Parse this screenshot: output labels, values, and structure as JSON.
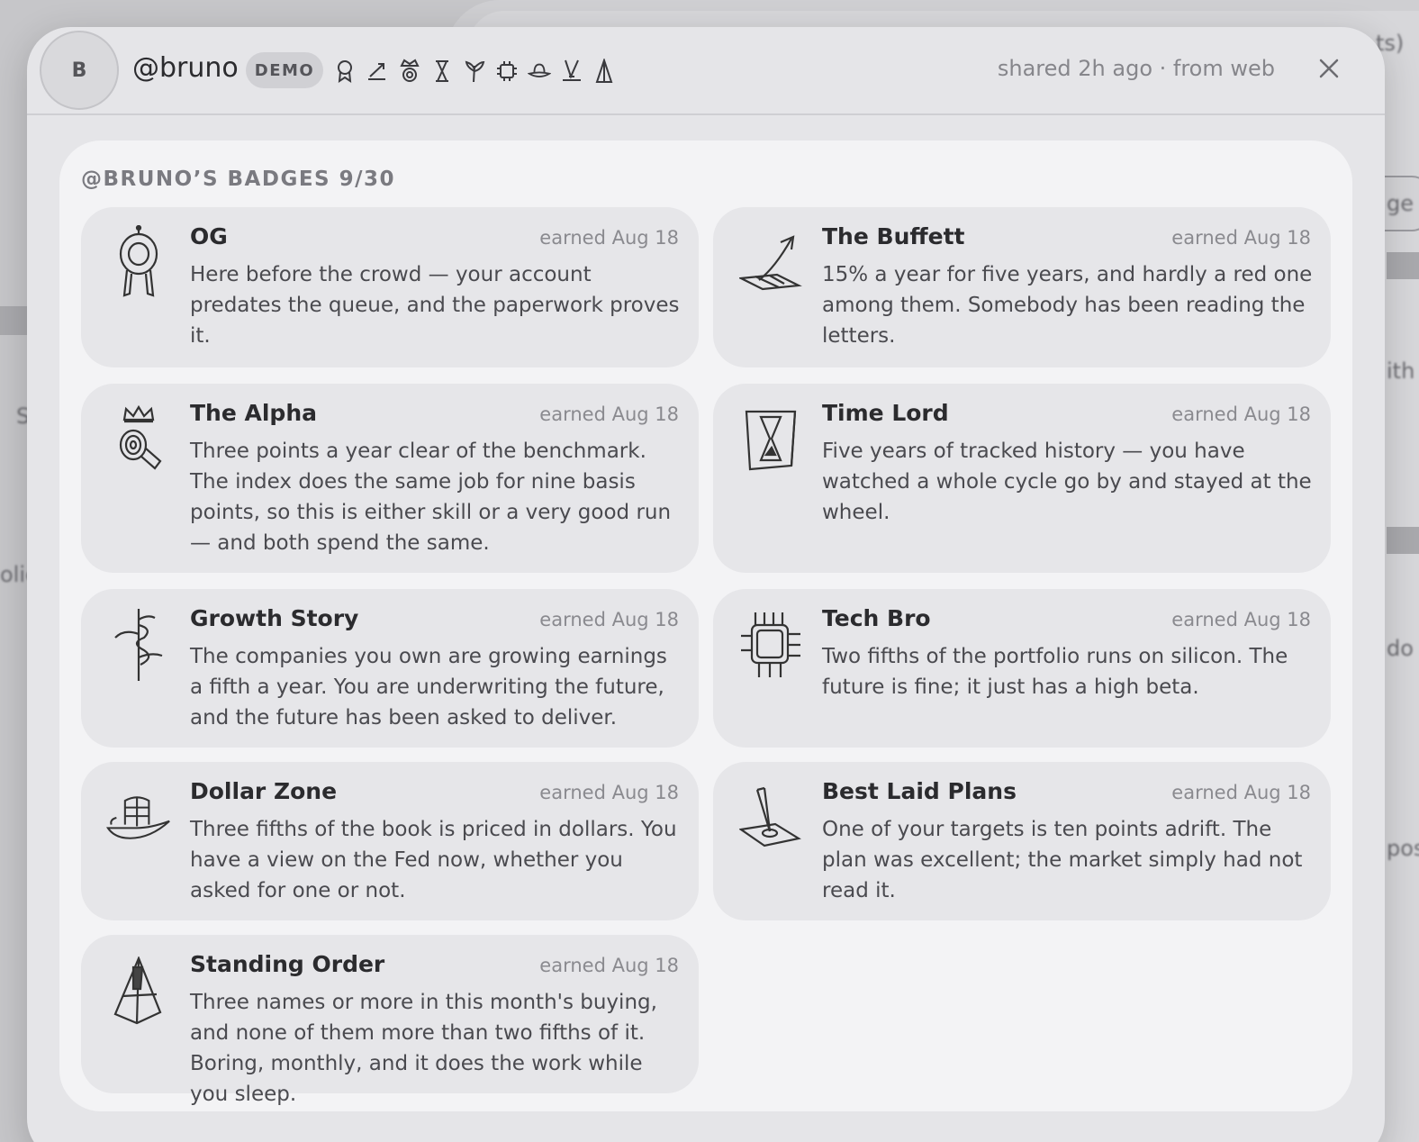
{
  "background": {
    "fragments": [
      "ts)",
      "ge",
      "ith",
      "S",
      "olic",
      "do",
      "post"
    ]
  },
  "header": {
    "avatar_initial": "B",
    "username": "@bruno",
    "demo_label": "DEMO",
    "icons": [
      "ribbon-icon",
      "chart-up-icon",
      "crown-icon",
      "hourglass-icon",
      "sprout-icon",
      "chip-icon",
      "hat-icon",
      "plan-icon",
      "pyramid-icon"
    ],
    "share_meta": "shared 2h ago · from web",
    "close_icon": "close-icon"
  },
  "badges": {
    "title": "@BRUNO’S BADGES 9/30",
    "items": [
      {
        "title": "OG",
        "earned": "earned Aug 18",
        "icon": "medal-icon",
        "desc": "Here before the crowd — your account predates the queue, and the paperwork proves it."
      },
      {
        "title": "The Buffett",
        "earned": "earned Aug 18",
        "icon": "chart-arrow-icon",
        "desc": "15% a year for five years, and hardly a red one among them. Somebody has been reading the letters."
      },
      {
        "title": "The Alpha",
        "earned": "earned Aug 18",
        "icon": "crown-coil-icon",
        "desc": "Three points a year clear of the benchmark. The index does the same job for nine basis points, so this is either skill or a very good run — and both spend the same."
      },
      {
        "title": "Time Lord",
        "earned": "earned Aug 18",
        "icon": "hourglass-icon",
        "desc": "Five years of tracked history — you have watched a whole cycle go by and stayed at the wheel."
      },
      {
        "title": "Growth Story",
        "earned": "earned Aug 18",
        "icon": "sprout-icon",
        "desc": "The companies you own are growing earnings a fifth a year. You are underwriting the future, and the future has been asked to deliver."
      },
      {
        "title": "Tech Bro",
        "earned": "earned Aug 18",
        "icon": "chip-icon",
        "desc": "Two fifths of the portfolio runs on silicon. The future is fine; it just has a high beta."
      },
      {
        "title": "Dollar Zone",
        "earned": "earned Aug 18",
        "icon": "cowboy-hat-icon",
        "desc": "Three fifths of the book is priced in dollars. You have a view on the Fed now, whether you asked for one or not."
      },
      {
        "title": "Best Laid Plans",
        "earned": "earned Aug 18",
        "icon": "blueprint-icon",
        "desc": "One of your targets is ten points adrift. The plan was excellent; the market simply had not read it."
      },
      {
        "title": "Standing Order",
        "earned": "earned Aug 18",
        "icon": "pyramid-icon",
        "desc": "Three names or more in this month's buying, and none of them more than two fifths of it. Boring, monthly, and it does the work while you sleep."
      }
    ]
  },
  "colors": {
    "panel": "#f3f3f5",
    "card": "#e6e6e9",
    "modal": "#e5e5e8",
    "muted_text": "#8a8a8f"
  }
}
